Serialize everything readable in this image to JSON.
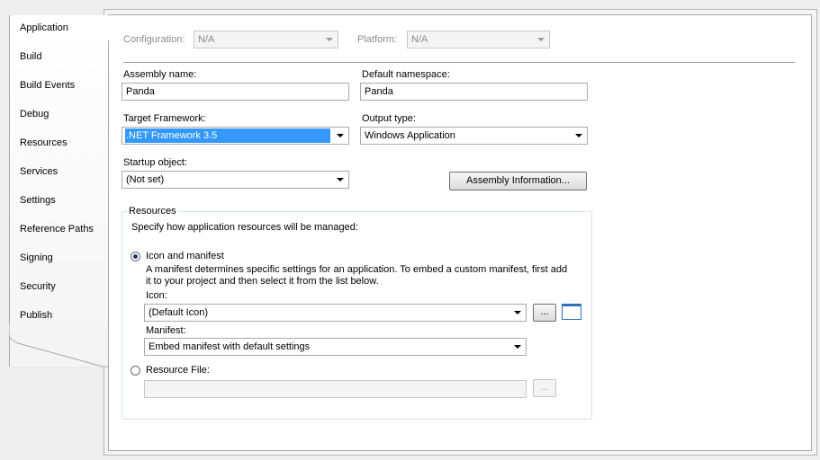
{
  "tabs": [
    {
      "label": "Application",
      "active": true
    },
    {
      "label": "Build"
    },
    {
      "label": "Build Events"
    },
    {
      "label": "Debug"
    },
    {
      "label": "Resources"
    },
    {
      "label": "Services"
    },
    {
      "label": "Settings"
    },
    {
      "label": "Reference Paths"
    },
    {
      "label": "Signing"
    },
    {
      "label": "Security"
    },
    {
      "label": "Publish"
    }
  ],
  "config": {
    "configuration_label": "Configuration:",
    "configuration_value": "N/A",
    "platform_label": "Platform:",
    "platform_value": "N/A"
  },
  "form": {
    "assembly_name_label": "Assembly name:",
    "assembly_name_value": "Panda",
    "default_namespace_label": "Default namespace:",
    "default_namespace_value": "Panda",
    "target_framework_label": "Target Framework:",
    "target_framework_value": ".NET Framework 3.5",
    "output_type_label": "Output type:",
    "output_type_value": "Windows Application",
    "startup_object_label": "Startup object:",
    "startup_object_value": "(Not set)",
    "assembly_info_button": "Assembly Information..."
  },
  "resources": {
    "group_title": "Resources",
    "description": "Specify how application resources will be managed:",
    "icon_manifest_label": "Icon and manifest",
    "icon_manifest_desc_1": "A manifest determines specific settings for an application. To embed a custom manifest, first add",
    "icon_manifest_desc_2": "it to your project and then select it from the list below.",
    "icon_label": "Icon:",
    "icon_value": "(Default Icon)",
    "browse_button": "...",
    "manifest_label": "Manifest:",
    "manifest_value": "Embed manifest with default settings",
    "resource_file_label": "Resource File:",
    "resource_file_value": "",
    "resource_browse_button": "..."
  },
  "colors": {
    "selection": "#3399ff",
    "icon_accent": "#2b6fbd"
  }
}
